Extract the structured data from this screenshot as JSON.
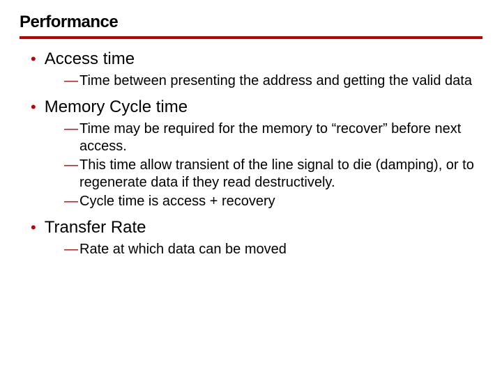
{
  "slide": {
    "title": "Performance",
    "items": [
      {
        "label": "Access time",
        "subs": [
          "Time between presenting the address and getting the valid data"
        ]
      },
      {
        "label": "Memory Cycle time",
        "subs": [
          "Time may be required for the memory to “recover” before next access.",
          "This time allow transient of the line signal to die (damping), or to regenerate data if they read destructively.",
          "Cycle time is access + recovery"
        ]
      },
      {
        "label": "Transfer Rate",
        "subs": [
          "Rate at which data can be moved"
        ]
      }
    ]
  }
}
